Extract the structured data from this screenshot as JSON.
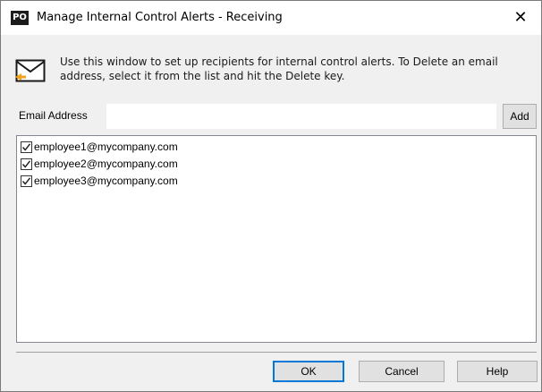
{
  "window": {
    "app_icon_text": "PO",
    "title": "Manage Internal Control Alerts - Receiving",
    "close_glyph": "✕"
  },
  "info": {
    "icon": "envelope-icon",
    "text": "Use this window to set up recipients for internal control alerts. To Delete an email address, select it from the list and hit the Delete key."
  },
  "email": {
    "label": "Email Address",
    "value": "",
    "placeholder": "",
    "add_label": "Add"
  },
  "recipients": [
    {
      "email": "employee1@mycompany.com",
      "checked": true
    },
    {
      "email": "employee2@mycompany.com",
      "checked": true
    },
    {
      "email": "employee3@mycompany.com",
      "checked": true
    }
  ],
  "buttons": {
    "ok": "OK",
    "cancel": "Cancel",
    "help": "Help"
  },
  "colors": {
    "dialog_bg": "#f0f0f0",
    "accent": "#0078d7",
    "icon_orange": "#f4a11d"
  }
}
